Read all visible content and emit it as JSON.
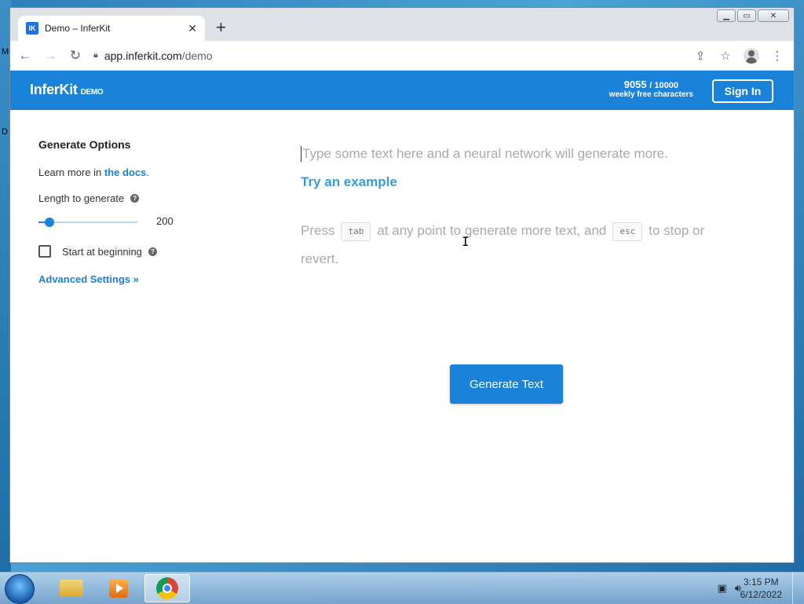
{
  "desktop": {
    "glyphs": [
      "M",
      "D"
    ]
  },
  "window": {
    "controls": [
      "minimize",
      "maximize",
      "close"
    ]
  },
  "browser": {
    "tab": {
      "favicon_text": "IK",
      "title": "Demo – InferKit"
    },
    "url_host": "app.inferkit.com",
    "url_path": "/demo"
  },
  "site": {
    "logo": "InferKit",
    "logo_badge": "DEMO",
    "quota_used": "9055",
    "quota_total": "/ 10000",
    "quota_label": "weekly free characters",
    "signin_label": "Sign In"
  },
  "sidebar": {
    "title": "Generate Options",
    "docs_prefix": "Learn more in ",
    "docs_link": "the docs",
    "docs_suffix": ".",
    "length_label": "Length to generate",
    "length_value": "200",
    "slider_fraction": 0.11,
    "start_label": "Start at beginning",
    "start_checked": false,
    "advanced_label": "Advanced Settings »"
  },
  "editor": {
    "placeholder": "Type some text here and a neural network will generate more.",
    "try_example": "Try an example",
    "hint_press": "Press",
    "hint_tab": "tab",
    "hint_mid": "at any point to generate more text, and",
    "hint_esc": "esc",
    "hint_end": "to stop or revert."
  },
  "generate_label": "Generate Text",
  "taskbar": {
    "apps": [
      "file-explorer",
      "media-player",
      "chrome"
    ],
    "time": "3:15 PM",
    "date": "6/12/2022"
  },
  "colors": {
    "brand": "#1a82d8",
    "link": "#3a9ad9"
  }
}
